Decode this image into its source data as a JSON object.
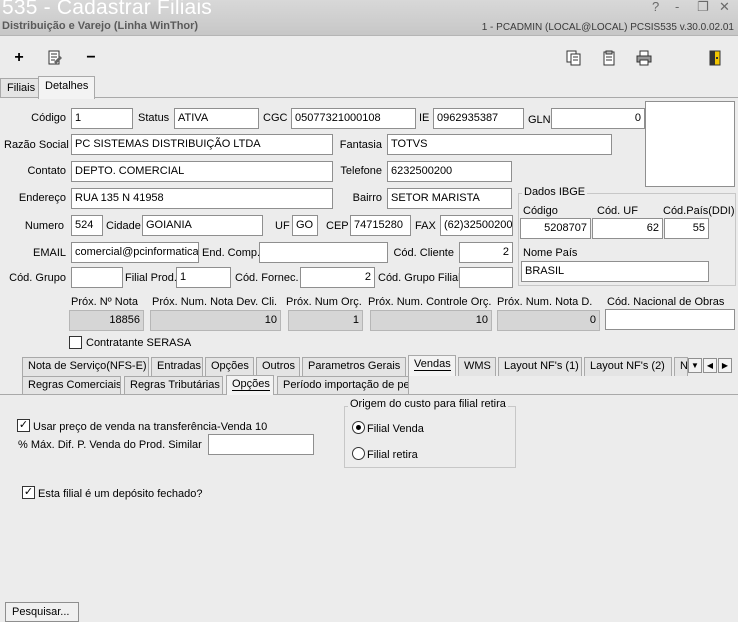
{
  "window": {
    "title": "535 - Cadastrar Filiais",
    "subtitle": "Distribuição e Varejo (Linha WinThor)",
    "user_info": "1 - PCADMIN (LOCAL@LOCAL)   PCSIS535  v.30.0.02.01",
    "help_glyph": "?",
    "min_glyph": "‑",
    "max_glyph": "❐",
    "close_glyph": "✕"
  },
  "toolbar": {
    "add_glyph": "+",
    "remove_glyph": "−",
    "icons": [
      "add-icon",
      "edit-document-icon",
      "remove-icon",
      "copy-icon",
      "clipboard-icon",
      "print-icon",
      "exit-icon"
    ]
  },
  "top_tabs": [
    {
      "label": "Filiais",
      "active": false
    },
    {
      "label": "Detalhes",
      "active": true
    }
  ],
  "form": {
    "codigo": {
      "label": "Código",
      "value": "1"
    },
    "status": {
      "label": "Status",
      "value": "ATIVA"
    },
    "cgc": {
      "label": "CGC",
      "value": "05077321000108"
    },
    "ie": {
      "label": "IE",
      "value": "0962935387"
    },
    "gln": {
      "label": "GLN",
      "value": "0"
    },
    "razao_social": {
      "label": "Razão Social",
      "value": "PC SISTEMAS DISTRIBUIÇÃO LTDA"
    },
    "fantasia": {
      "label": "Fantasia",
      "value": "TOTVS"
    },
    "contato": {
      "label": "Contato",
      "value": "DEPTO. COMERCIAL"
    },
    "telefone": {
      "label": "Telefone",
      "value": "6232500200"
    },
    "endereco": {
      "label": "Endereço",
      "value": "RUA 135 N 41958"
    },
    "bairro": {
      "label": "Bairro",
      "value": "SETOR MARISTA"
    },
    "numero": {
      "label": "Numero",
      "value": "524"
    },
    "cidade": {
      "label": "Cidade",
      "value": "GOIANIA"
    },
    "uf": {
      "label": "UF",
      "value": "GO"
    },
    "cep": {
      "label": "CEP",
      "value": "74715280"
    },
    "fax": {
      "label": "FAX",
      "value": "(62)32500200"
    },
    "email": {
      "label": "EMAIL",
      "value": "comercial@pcinformatica.c"
    },
    "end_comp": {
      "label": "End. Comp.",
      "value": ""
    },
    "cod_cliente": {
      "label": "Cód. Cliente",
      "value": "2"
    },
    "cod_grupo": {
      "label": "Cód. Grupo",
      "value": ""
    },
    "filial_prod": {
      "label": "Filial Prod.",
      "value": "1"
    },
    "cod_fornec": {
      "label": "Cód. Fornec.",
      "value": "2"
    },
    "cod_grupo_filial": {
      "label": "Cód. Grupo Filial",
      "value": ""
    }
  },
  "ibge": {
    "title": "Dados IBGE",
    "codigo_label": "Código",
    "codigo_value": "5208707",
    "cod_uf_label": "Cód. UF",
    "cod_uf_value": "62",
    "cod_pais_label": "Cód.País(DDI)",
    "cod_pais_value": "55",
    "nome_pais_label": "Nome País",
    "nome_pais_value": "BRASIL"
  },
  "next_numbers": {
    "prox_nota": {
      "label": "Próx. Nº Nota",
      "value": "18856"
    },
    "prox_nota_dev": {
      "label": "Próx. Num. Nota Dev. Cli.",
      "value": "10"
    },
    "prox_orc": {
      "label": "Próx. Num Orç.",
      "value": "1"
    },
    "prox_controle_orc": {
      "label": "Próx. Num. Controle Orç.",
      "value": "10"
    },
    "prox_nota_d": {
      "label": "Próx. Num. Nota D.",
      "value": "0"
    },
    "cod_nacional_obras": {
      "label": "Cód. Nacional de Obras",
      "value": ""
    }
  },
  "serasa": {
    "label": "Contratante SERASA",
    "checked": false
  },
  "tabs_row1": [
    {
      "label": "Nota de Serviço(NFS-E)",
      "active": false
    },
    {
      "label": "Entradas",
      "active": false
    },
    {
      "label": "Opções",
      "active": false
    },
    {
      "label": "Outros",
      "active": false
    },
    {
      "label": "Parametros Gerais",
      "active": false
    },
    {
      "label": "Vendas",
      "active": true
    },
    {
      "label": "WMS",
      "active": false
    },
    {
      "label": "Layout NF's (1)",
      "active": false
    },
    {
      "label": "Layout NF's (2)",
      "active": false
    },
    {
      "label": "N",
      "active": false
    }
  ],
  "tab_nav": {
    "down": "▼",
    "left": "◀",
    "right": "▶"
  },
  "tabs_row2": [
    {
      "label": "Regras Comerciais",
      "active": false
    },
    {
      "label": "Regras Tributárias",
      "active": false
    },
    {
      "label": "Opções",
      "active": true
    },
    {
      "label": "Período importação de pedidos",
      "active": false
    }
  ],
  "options": {
    "usar_preco": {
      "label": "Usar preço de venda na transferência-Venda 10",
      "checked": true
    },
    "max_dif": {
      "label": "% Máx. Dif. P. Venda do Prod. Similar",
      "value": ""
    },
    "deposito_fechado": {
      "label": "Esta filial é um depósito fechado?",
      "checked": true
    },
    "origem_custo": {
      "title": "Origem do custo para filial retira",
      "opt1": "Filial Venda",
      "opt2": "Filial retira",
      "selected": "Filial Venda"
    },
    "check_glyph": "✓"
  },
  "search_button": {
    "label": "Pesquisar..."
  }
}
